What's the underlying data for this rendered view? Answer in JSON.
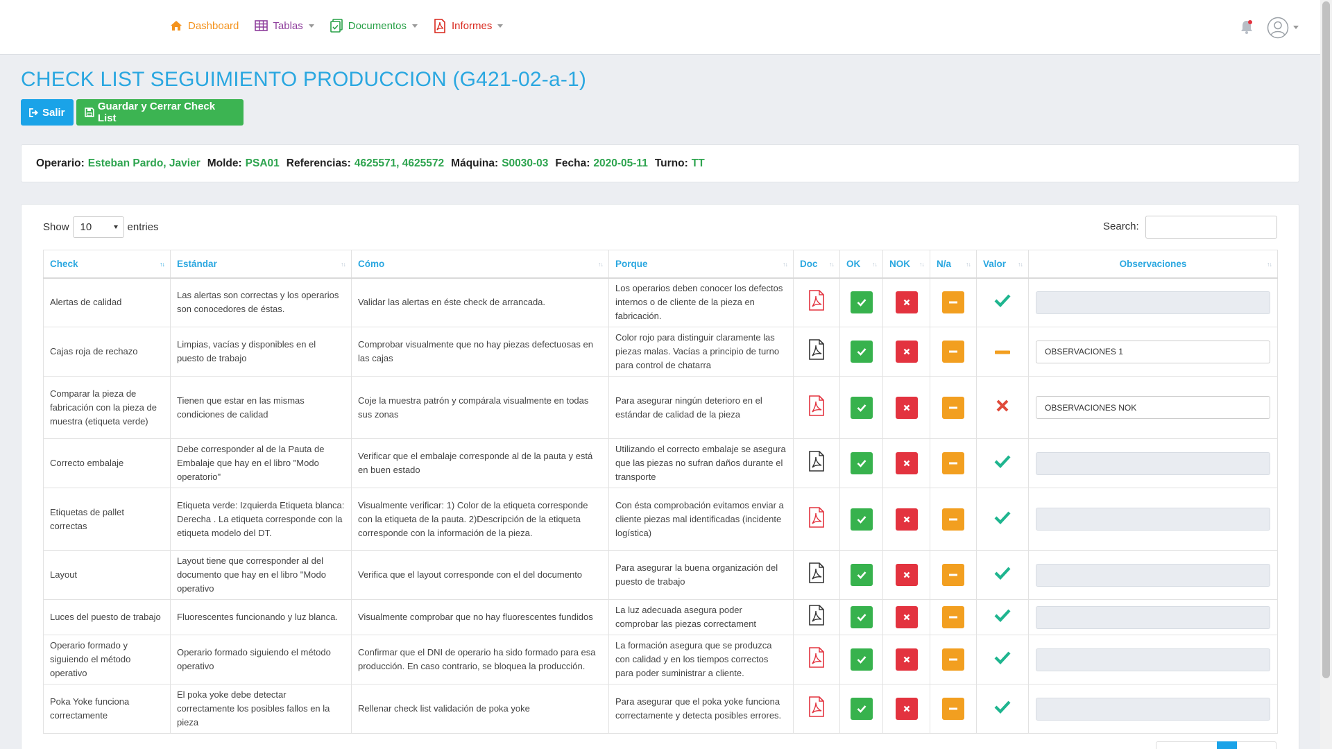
{
  "nav": {
    "dashboard": "Dashboard",
    "tablas": "Tablas",
    "documentos": "Documentos",
    "informes": "Informes"
  },
  "page": {
    "title": "CHECK LIST SEGUIMIENTO PRODUCCION (G421-02-a-1)",
    "btn_salir": "Salir",
    "btn_guardar": "Guardar y Cerrar Check List"
  },
  "info": {
    "operario_label": "Operario:",
    "operario": "Esteban Pardo, Javier",
    "molde_label": "Molde:",
    "molde": "PSA01",
    "referencias_label": "Referencias:",
    "referencias": "4625571, 4625572",
    "maquina_label": "Máquina:",
    "maquina": "S0030-03",
    "fecha_label": "Fecha:",
    "fecha": "2020-05-11",
    "turno_label": "Turno:",
    "turno": "TT"
  },
  "table_controls": {
    "show_label": "Show",
    "entries_value": "10",
    "entries_label": "entries",
    "search_label": "Search:"
  },
  "columns": [
    "Check",
    "Estándar",
    "Cómo",
    "Porque",
    "Doc",
    "OK",
    "NOK",
    "N/a",
    "Valor",
    "Observaciones"
  ],
  "rows": [
    {
      "check": "Alertas de calidad",
      "estandar": "Las alertas son correctas y los operarios son conocedores de éstas.",
      "como": "Validar las alertas en éste check de arrancada.",
      "porque": "Los operarios deben conocer los defectos internos o de cliente de la pieza en fabricación.",
      "doc": "pdf-red",
      "valor": "ok",
      "obs": ""
    },
    {
      "check": "Cajas roja de rechazo",
      "estandar": "Limpias, vacías y disponibles en el puesto de trabajo",
      "como": "Comprobar visualmente que no hay piezas defectuosas en las cajas",
      "porque": "Color rojo para distinguir claramente las piezas malas. Vacías a principio de turno para control de chatarra",
      "doc": "pdf-black",
      "valor": "na",
      "obs": "OBSERVACIONES 1"
    },
    {
      "check": "Comparar la pieza de fabricación con la pieza de muestra (etiqueta verde)",
      "estandar": "Tienen que estar en las mismas condiciones de calidad",
      "como": "Coje la muestra patrón y compárala visualmente en todas sus zonas",
      "porque": "Para asegurar ningún deterioro en el estándar de calidad de la pieza",
      "doc": "pdf-red",
      "valor": "nok",
      "obs": "OBSERVACIONES NOK"
    },
    {
      "check": "Correcto embalaje",
      "estandar": "Debe corresponder al de la Pauta de Embalaje que hay en el libro \"Modo operatorio\"",
      "como": "Verificar que el embalaje corresponde al de la pauta y está en buen estado",
      "porque": "Utilizando el correcto embalaje se asegura que las piezas no sufran daños durante el transporte",
      "doc": "pdf-black",
      "valor": "ok",
      "obs": ""
    },
    {
      "check": "Etiquetas de pallet correctas",
      "estandar": "Etiqueta verde: Izquierda Etiqueta blanca: Derecha . La etiqueta corresponde con la etiqueta modelo del DT.",
      "como": "Visualmente verificar: 1) Color de la etiqueta corresponde con la etiqueta de la pauta. 2)Descripción de la etiqueta corresponde con la información de la pieza.",
      "porque": "Con ésta comprobación evitamos enviar a cliente piezas mal identificadas (incidente logística)",
      "doc": "pdf-red",
      "valor": "ok",
      "obs": ""
    },
    {
      "check": "Layout",
      "estandar": "Layout tiene que corresponder al del documento que hay en el libro \"Modo operativo",
      "como": "Verifica que el layout corresponde con el del documento",
      "porque": "Para asegurar la buena organización del puesto de trabajo",
      "doc": "pdf-black",
      "valor": "ok",
      "obs": ""
    },
    {
      "check": "Luces del puesto de trabajo",
      "estandar": "Fluorescentes funcionando y luz blanca.",
      "como": "Visualmente comprobar que no hay fluorescentes fundidos",
      "porque": "La luz adecuada asegura poder comprobar las piezas correctament",
      "doc": "pdf-black",
      "valor": "ok",
      "obs": ""
    },
    {
      "check": "Operario formado y siguiendo el método operativo",
      "estandar": "Operario formado siguiendo el método operativo",
      "como": "Confirmar que el DNI de operario ha sido formado para esa producción. En caso contrario, se bloquea la producción.",
      "porque": "La formación asegura que se produzca con calidad y en los tiempos correctos para poder suministrar a cliente.",
      "doc": "pdf-red",
      "valor": "ok",
      "obs": ""
    },
    {
      "check": "Poka Yoke funciona correctamente",
      "estandar": "El poka yoke debe detectar correctamente los posibles fallos en la pieza",
      "como": "Rellenar check list validación de poka yoke",
      "porque": "Para asegurar que el poka yoke funciona correctamente y detecta posibles errores.",
      "doc": "pdf-red",
      "valor": "ok",
      "obs": ""
    }
  ],
  "colors": {
    "accent": "#2aa7e0",
    "ok": "#37b24d",
    "nok": "#e3333f",
    "na": "#f29f20",
    "valor_ok": "#1fb58f",
    "valor_nok": "#e04a3a",
    "valor_na": "#f29f20"
  }
}
